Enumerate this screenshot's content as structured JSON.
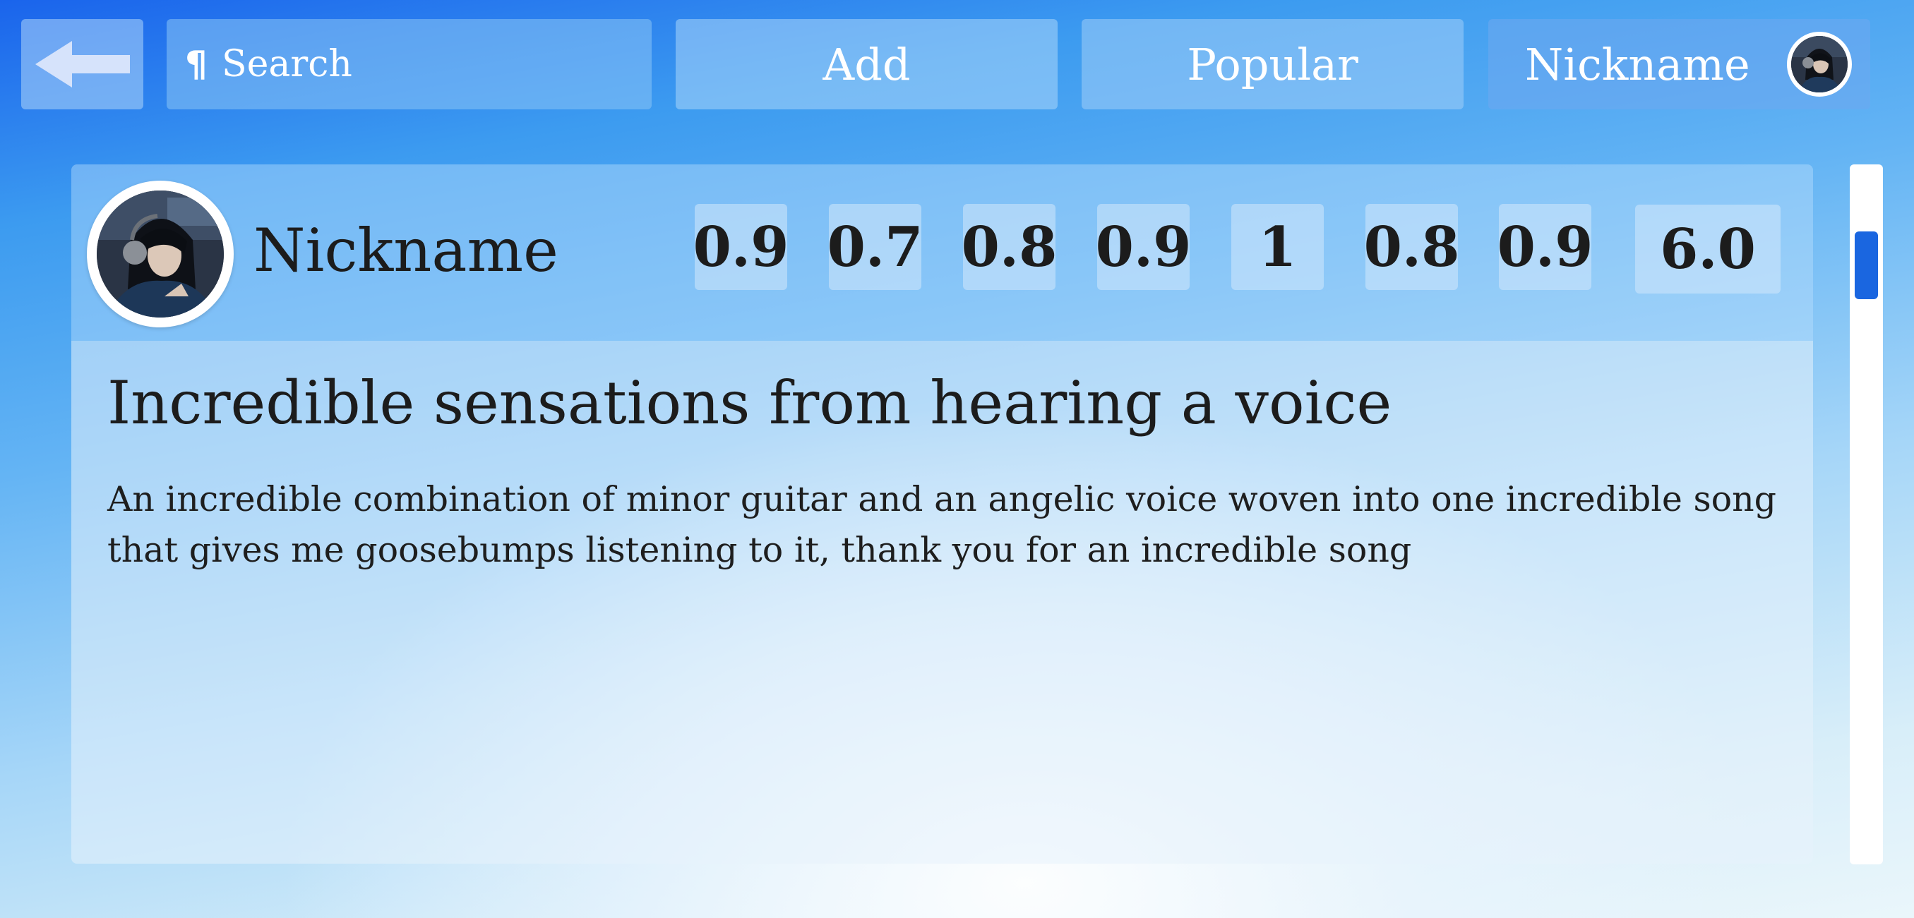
{
  "topbar": {
    "back_icon": "arrow-left-icon",
    "search_icon": "pilcrow-icon",
    "search_icon_glyph": "¶",
    "search_placeholder": "Search",
    "search_value": "",
    "add_label": "Add",
    "popular_label": "Popular",
    "profile_label": "Nickname"
  },
  "review": {
    "author": "Nickname",
    "scores": [
      "0.9",
      "0.7",
      "0.8",
      "0.9",
      "1",
      "0.8",
      "0.9"
    ],
    "total_score": "6.0",
    "title": "Incredible sensations from hearing a voice",
    "text": "An incredible combination of minor guitar and an angelic voice woven into one incredible song that gives me goosebumps listening to it, thank you for an incredible song"
  },
  "scrollbar": {
    "position_fraction": 0.1
  },
  "colors": {
    "accent": "#1a66e0",
    "text": "#1c1c1c",
    "button_text": "#ffffff"
  }
}
